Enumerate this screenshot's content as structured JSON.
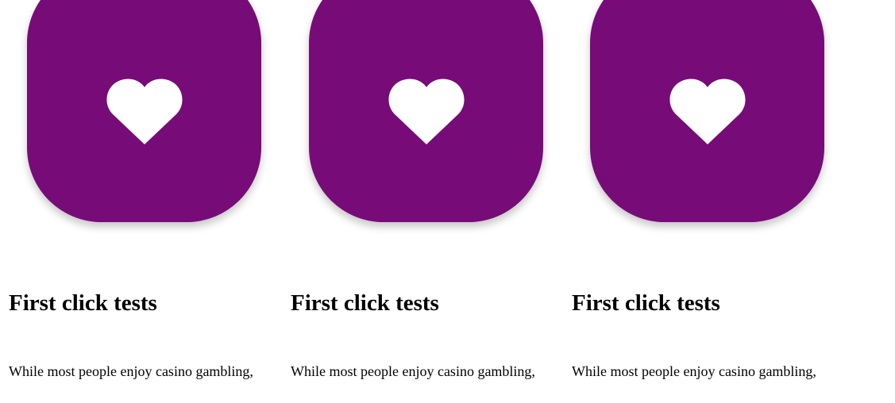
{
  "colors": {
    "tile": "#770b78",
    "heart": "#ffffff"
  },
  "cards": [
    {
      "icon": "heart-icon",
      "title": "First click tests",
      "text": "While most people enjoy casino gambling,"
    },
    {
      "icon": "heart-icon",
      "title": "First click tests",
      "text": "While most people enjoy casino gambling,"
    },
    {
      "icon": "heart-icon",
      "title": "First click tests",
      "text": "While most people enjoy casino gambling,"
    }
  ]
}
